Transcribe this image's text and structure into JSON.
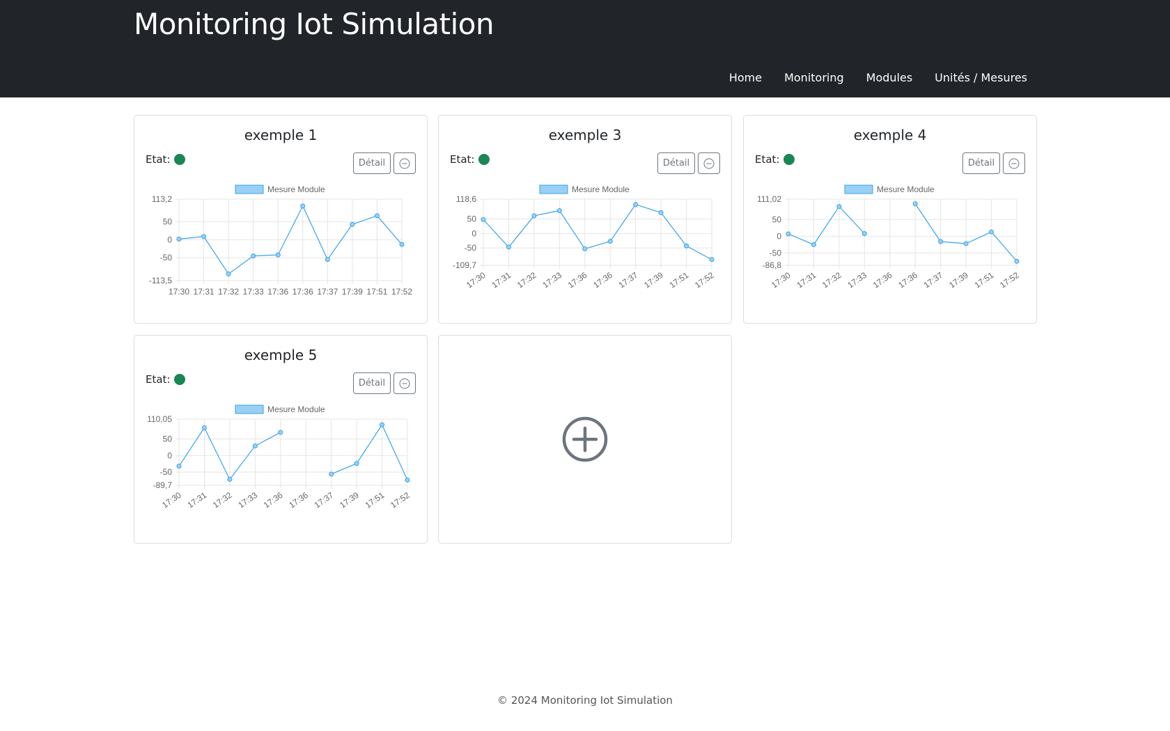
{
  "navbar": {
    "brand": "Monitoring Iot Simulation",
    "links": [
      "Home",
      "Monitoring",
      "Modules",
      "Unités / Mesures"
    ]
  },
  "cards": [
    {
      "title": "exemple 1",
      "etat_label": "Etat:",
      "detail_label": "Détail"
    },
    {
      "title": "exemple 3",
      "etat_label": "Etat:",
      "detail_label": "Détail"
    },
    {
      "title": "exemple 4",
      "etat_label": "Etat:",
      "detail_label": "Détail"
    },
    {
      "title": "exemple 5",
      "etat_label": "Etat:",
      "detail_label": "Détail"
    }
  ],
  "footer": "© 2024 Monitoring Iot Simulation",
  "colors": {
    "navbar": "#212529",
    "status_ok": "#198754",
    "line": "#36a2eb",
    "legend_fill": "#9ad0f5"
  },
  "chart_data": [
    {
      "type": "line",
      "legend": "Mesure Module",
      "categories": [
        "17:30",
        "17:31",
        "17:32",
        "17:33",
        "17:36",
        "17:36",
        "17:37",
        "17:39",
        "17:51",
        "17:52"
      ],
      "values": [
        2,
        9,
        -95,
        -45,
        -42,
        94,
        -55,
        43,
        67,
        -13
      ],
      "ylim": [
        -113.5,
        113.2
      ],
      "yticks": [
        "113,2",
        "50",
        "0",
        "-50",
        "-113,5"
      ],
      "ytick_values": [
        113.2,
        50,
        0,
        -50,
        -113.5
      ],
      "rotated_labels": false
    },
    {
      "type": "line",
      "legend": "Mesure Module",
      "categories": [
        "17:30",
        "17:31",
        "17:32",
        "17:33",
        "17:36",
        "17:36",
        "17:37",
        "17:39",
        "17:51",
        "17:52"
      ],
      "values": [
        48,
        -47,
        61,
        79,
        -53,
        -27,
        100,
        72,
        -43,
        -90
      ],
      "ylim": [
        -109.7,
        118.6
      ],
      "yticks": [
        "118,6",
        "50",
        "0",
        "-50",
        "-109,7"
      ],
      "ytick_values": [
        118.6,
        50,
        0,
        -50,
        -109.7
      ],
      "rotated_labels": true
    },
    {
      "type": "line",
      "legend": "Mesure Module",
      "categories": [
        "17:30",
        "17:31",
        "17:32",
        "17:33",
        "17:36",
        "17:36",
        "17:37",
        "17:39",
        "17:51",
        "17:52"
      ],
      "values": [
        7,
        -25,
        89,
        8,
        null,
        97,
        -16,
        -22,
        13,
        -75
      ],
      "ylim": [
        -86.8,
        111.02
      ],
      "yticks": [
        "111,02",
        "50",
        "0",
        "-50",
        "-86,8"
      ],
      "ytick_values": [
        111.02,
        50,
        0,
        -50,
        -86.8
      ],
      "rotated_labels": true
    },
    {
      "type": "line",
      "legend": "Mesure Module",
      "categories": [
        "17:30",
        "17:31",
        "17:32",
        "17:33",
        "17:36",
        "17:36",
        "17:37",
        "17:39",
        "17:51",
        "17:52"
      ],
      "values": [
        -32,
        84,
        -72,
        29,
        70,
        null,
        -56,
        -24,
        93,
        -74
      ],
      "ylim": [
        -89.7,
        110.05
      ],
      "yticks": [
        "110,05",
        "50",
        "0",
        "-50",
        "-89,7"
      ],
      "ytick_values": [
        110.05,
        50,
        0,
        -50,
        -89.7
      ],
      "rotated_labels": true
    }
  ]
}
